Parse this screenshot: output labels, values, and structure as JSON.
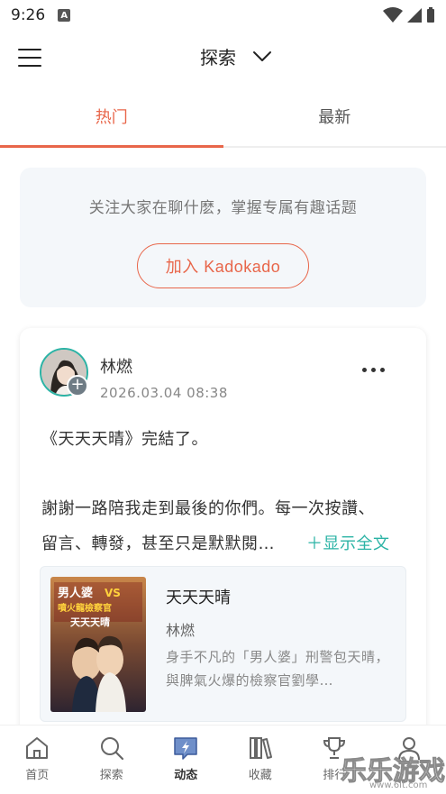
{
  "status_bar": {
    "time": "9:26",
    "notification_badge": "A"
  },
  "header": {
    "title": "探索"
  },
  "tabs": [
    {
      "label": "热门",
      "active": true
    },
    {
      "label": "最新",
      "active": false
    }
  ],
  "join_card": {
    "text": "关注大家在聊什麽，掌握专属有趣话题",
    "button_label": "加入 Kadokado"
  },
  "post": {
    "author": "林燃",
    "date": "2026.03.04 08:38",
    "line1": "《天天天晴》完結了。",
    "line2": "謝謝一路陪我走到最後的你們。每一次按讚、",
    "line3": "留言、轉發，甚至只是默默閱…",
    "show_full": "＋显示全文",
    "book": {
      "title": "天天天晴",
      "author": "林燃",
      "description": "身手不凡的「男人婆」刑警包天晴，與脾氣火爆的檢察官劉學…",
      "cover_text": "男人婆VS噴火龍檢察官 天天天晴"
    }
  },
  "bottom_nav": [
    {
      "label": "首页",
      "icon": "home-icon",
      "active": false
    },
    {
      "label": "探索",
      "icon": "search-icon",
      "active": false
    },
    {
      "label": "动态",
      "icon": "activity-icon",
      "active": true
    },
    {
      "label": "收藏",
      "icon": "bookshelf-icon",
      "active": false
    },
    {
      "label": "排行",
      "icon": "trophy-icon",
      "active": false
    }
  ],
  "watermark": {
    "text": "乐乐游戏",
    "url": "www.6lt.com"
  },
  "colors": {
    "accent": "#e8664a",
    "teal": "#2bb3a5"
  }
}
